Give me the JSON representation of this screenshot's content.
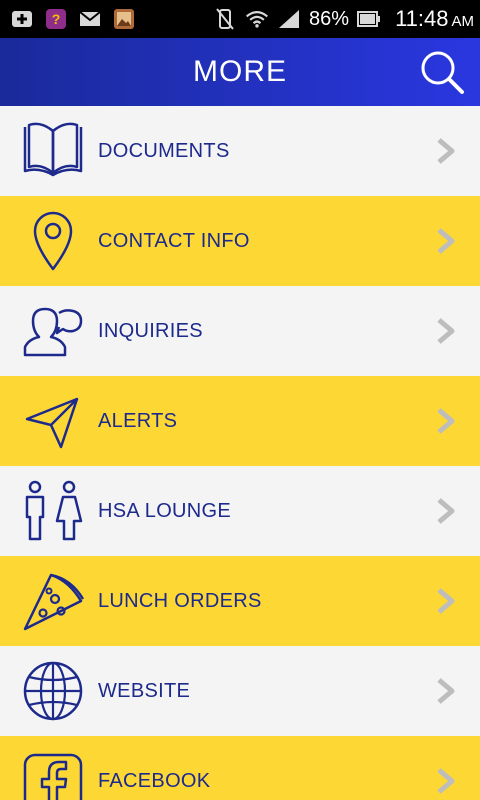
{
  "status_bar": {
    "battery_percent": "86%",
    "time": "11:48",
    "ampm": "AM",
    "icons_left": [
      "add-notification-icon",
      "question-app-icon",
      "mail-icon",
      "image-icon"
    ],
    "icons_right": [
      "vibrate-silent-icon",
      "wifi-icon",
      "signal-icon",
      "battery-icon"
    ]
  },
  "header": {
    "title": "MORE",
    "search_icon": "search-icon"
  },
  "colors": {
    "header_start": "#1a2a9a",
    "header_end": "#2a37e0",
    "row_light": "#f4f4f4",
    "row_yellow": "#fdd835",
    "text": "#1d2a8c",
    "chevron": "#bdbdbd"
  },
  "menu": {
    "items": [
      {
        "label": "DOCUMENTS",
        "icon": "book-icon"
      },
      {
        "label": "CONTACT INFO",
        "icon": "location-pin-icon"
      },
      {
        "label": "INQUIRIES",
        "icon": "person-speech-icon"
      },
      {
        "label": "ALERTS",
        "icon": "paper-plane-icon"
      },
      {
        "label": "HSA LOUNGE",
        "icon": "restroom-people-icon"
      },
      {
        "label": "LUNCH ORDERS",
        "icon": "pizza-slice-icon"
      },
      {
        "label": "WEBSITE",
        "icon": "globe-icon"
      },
      {
        "label": "FACEBOOK",
        "icon": "facebook-icon"
      }
    ]
  }
}
